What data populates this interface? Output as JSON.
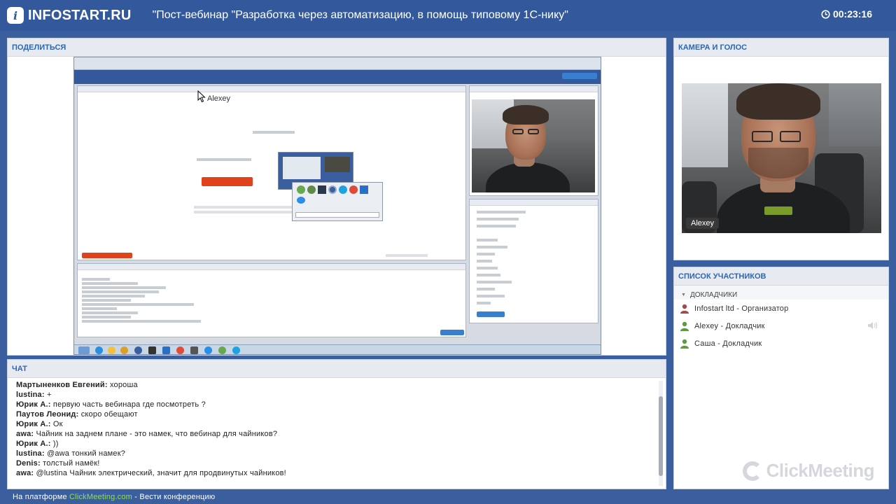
{
  "topbar": {
    "logo_letter": "i",
    "logo_text": "INFOSTART.RU",
    "title": "\"Пост-вебинар \"Разработка через автоматизацию, в помощь типовому 1С-нику\"",
    "timer": "00:23:16",
    "clock_icon": "clock-icon"
  },
  "share": {
    "header": "ПОДЕЛИТЬСЯ",
    "cursor_label": "Alexey"
  },
  "camera": {
    "header": "КАМЕРА И ГОЛОС",
    "name_label": "Alexey"
  },
  "participants": {
    "header": "СПИСОК УЧАСТНИКОВ",
    "group": "ДОКЛАДЧИКИ",
    "rows": [
      {
        "text": "Infostart ltd - Организатор",
        "role": "organizer",
        "color": "#a14a4a"
      },
      {
        "text": "Alexey - Докладчик",
        "role": "presenter",
        "color": "#5c9b3e"
      },
      {
        "text": "Саша - Докладчик",
        "role": "presenter",
        "color": "#5c9b3e"
      }
    ],
    "brand": "ClickMeeting"
  },
  "chat": {
    "header": "ЧАТ",
    "messages": [
      {
        "author": "Мартыненков Евгений:",
        "text": " хороша"
      },
      {
        "author": "lustina:",
        "text": " +"
      },
      {
        "author": "Юрик А.:",
        "text": " первую часть вебинара где посмотреть ?"
      },
      {
        "author": "Паутов Леонид:",
        "text": " скоро обещают"
      },
      {
        "author": "Юрик А.:",
        "text": " Ок"
      },
      {
        "author": "awa:",
        "text": " Чайник на заднем плане - это намек, что вебинар для чайников?"
      },
      {
        "author": "Юрик А.:",
        "text": " ))"
      },
      {
        "author": "lustina:",
        "text": " @awa тонкий намек?"
      },
      {
        "author": "Denis:",
        "text": " толстый намёк!"
      },
      {
        "author": "awa:",
        "text": " @lustina Чайник электрический, значит для продвинутых чайников!"
      }
    ]
  },
  "footer": {
    "prefix": "На платформе ",
    "link": "ClickMeeting.com",
    "suffix": " - Вести конференцию"
  },
  "colors": {
    "background": "#3b5f9e",
    "topbar": "#33599c",
    "header_text": "#2d66b3",
    "footer_link": "#8de04a"
  }
}
